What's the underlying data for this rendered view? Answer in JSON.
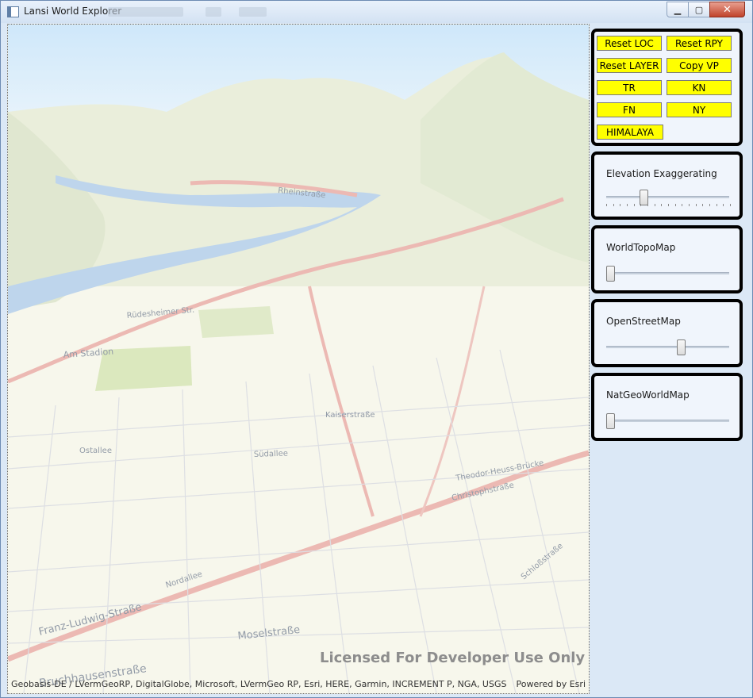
{
  "window": {
    "title": "Lansi World Explorer",
    "min_icon": "minimize-icon",
    "max_icon": "maximize-icon",
    "close_icon": "close-icon"
  },
  "map": {
    "street_labels": [
      "Rheinstraße",
      "Am Stadion",
      "Rüdesheimer Str.",
      "Kaiserstraße",
      "Bruchhausenstraße",
      "Franz-Ludwig-Straße",
      "Moselstraße",
      "Nordallee",
      "Theodor-Heuss-Brücke",
      "Christophstraße",
      "Südallee",
      "Schloßstraße",
      "Ostallee"
    ],
    "license_text": "Licensed For Developer Use Only",
    "attribution": "Geobasis-DE / LVermGeoRP, DigitalGlobe, Microsoft, LVermGeo RP, Esri, HERE, Garmin, INCREMENT P, NGA, USGS",
    "powered_by": "Powered by Esri"
  },
  "buttons": {
    "reset_loc": "Reset LOC",
    "reset_rpy": "Reset RPY",
    "reset_layer": "Reset LAYER",
    "copy_vp": "Copy VP",
    "tr": "TR",
    "kn": "KN",
    "fn": "FN",
    "ny": "NY",
    "himalaya": "HIMALAYA"
  },
  "sliders": {
    "elevation": {
      "label": "Elevation Exaggerating",
      "value": 0.29
    },
    "world_topo": {
      "label": "WorldTopoMap",
      "value": 0.0
    },
    "open_street": {
      "label": "OpenStreetMap",
      "value": 0.62
    },
    "natgeo": {
      "label": "NatGeoWorldMap",
      "value": 0.0
    }
  },
  "colors": {
    "button_yellow": "#ffff00",
    "panel_border": "#000000",
    "river": "#a9c7e6"
  }
}
